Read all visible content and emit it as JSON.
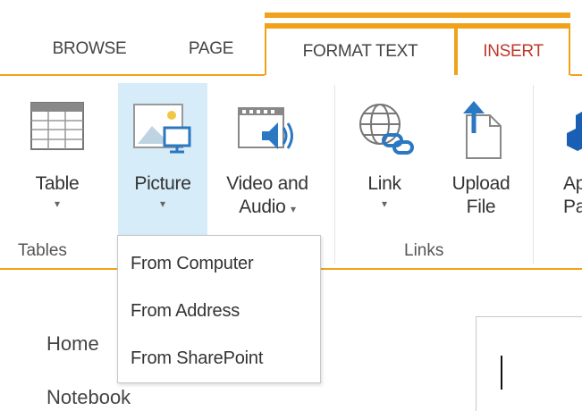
{
  "tabs": [
    {
      "label": "BROWSE"
    },
    {
      "label": "PAGE"
    },
    {
      "label": "FORMAT TEXT"
    },
    {
      "label": "INSERT"
    }
  ],
  "ribbon": {
    "table": {
      "label": "Table",
      "arrow": "▾"
    },
    "picture": {
      "label": "Picture",
      "arrow": "▾"
    },
    "video": {
      "label_line1": "Video and",
      "label_line2": "Audio",
      "arrow": "▾"
    },
    "link": {
      "label": "Link",
      "arrow": "▾"
    },
    "upload": {
      "label_line1": "Upload",
      "label_line2": "File"
    },
    "app": {
      "label_line1": "Ap",
      "label_line2": "Pa"
    }
  },
  "groups": {
    "tables": "Tables",
    "links": "Links"
  },
  "picture_menu": [
    {
      "label": "From Computer"
    },
    {
      "label": "From Address"
    },
    {
      "label": "From SharePoint"
    }
  ],
  "nav": {
    "home": "Home",
    "notebook": "Notebook"
  },
  "colors": {
    "accent": "#f0a21b",
    "active_tab_text": "#c0392b",
    "selected_button_bg": "#d6ecf8"
  }
}
